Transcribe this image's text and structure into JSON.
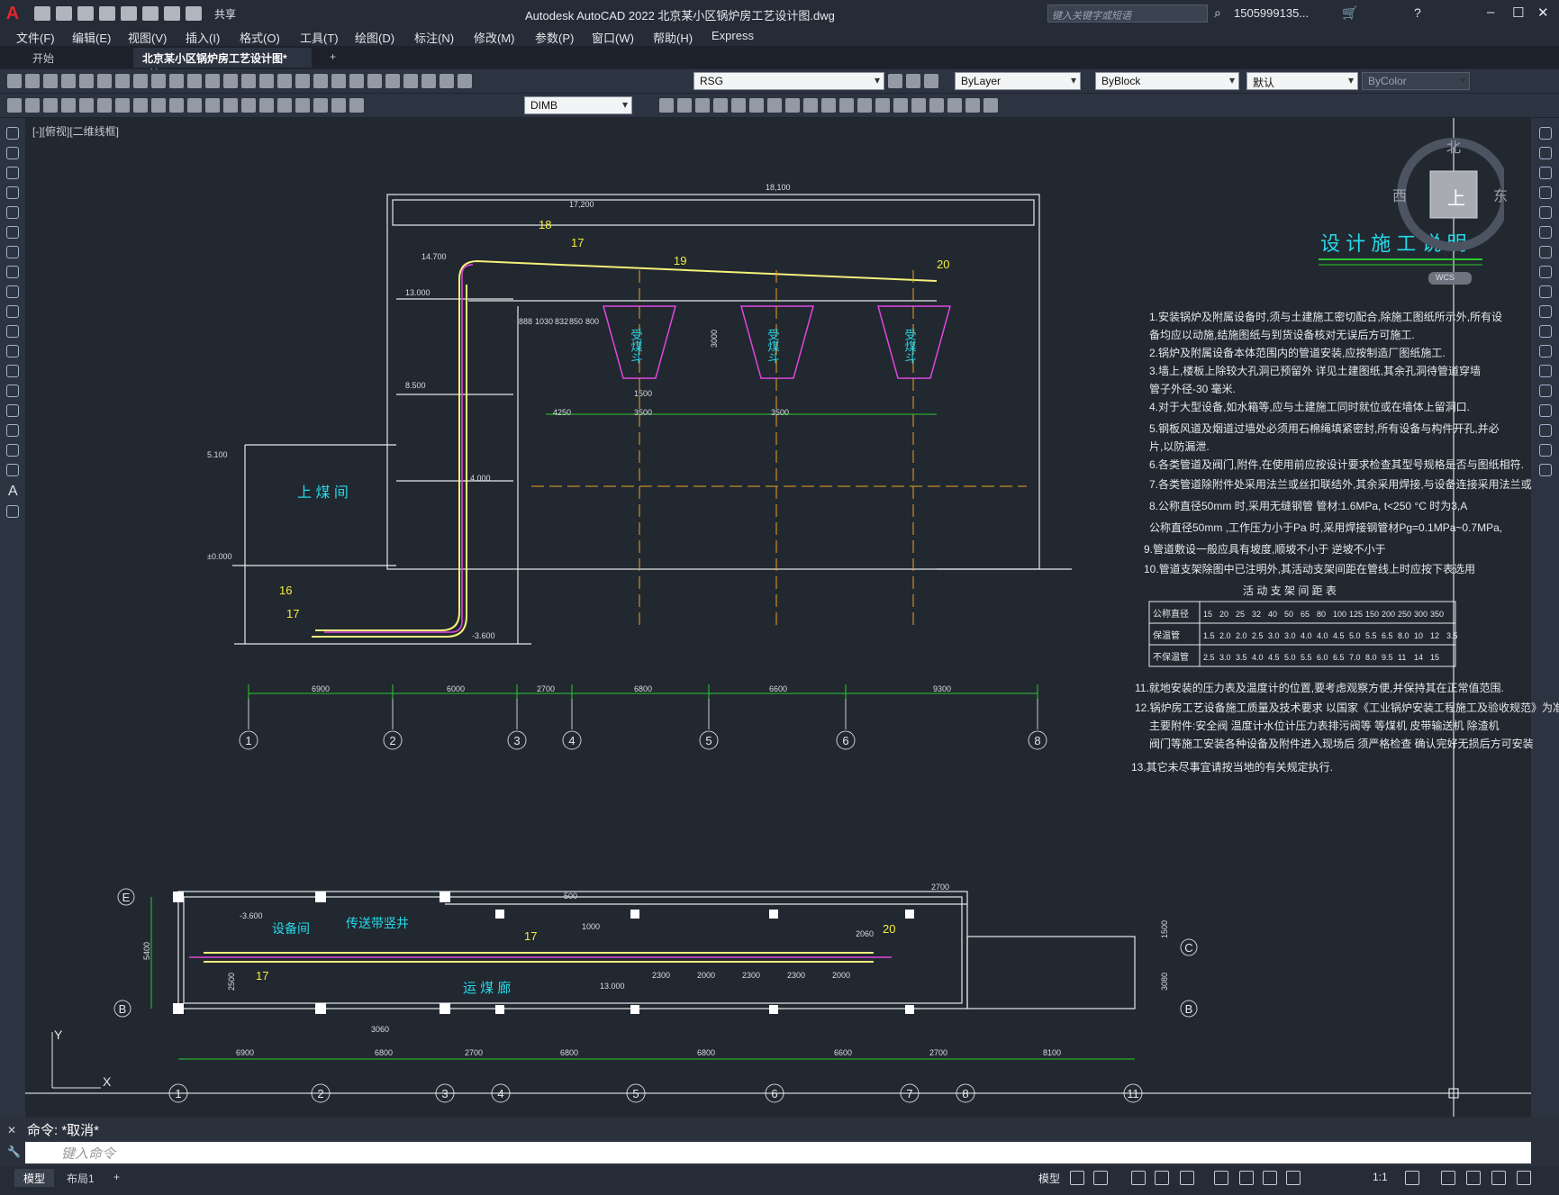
{
  "app": {
    "window_title": "Autodesk AutoCAD 2022    北京某小区锅炉房工艺设计图.dwg",
    "share_label": "共享",
    "search_placeholder": "键入关键字或短语",
    "user_name": "1505999135...",
    "window_controls": [
      "minimize-icon",
      "maximize-icon",
      "close-icon"
    ]
  },
  "menu": [
    "文件(F)",
    "编辑(E)",
    "视图(V)",
    "插入(I)",
    "格式(O)",
    "工具(T)",
    "绘图(D)",
    "标注(N)",
    "修改(M)",
    "参数(P)",
    "窗口(W)",
    "帮助(H)",
    "Express"
  ],
  "tabs": {
    "start": "开始",
    "active": "北京某小区锅炉房工艺设计图*",
    "add": "+"
  },
  "toolbar": {
    "layer": "RSG",
    "color": "ByLayer",
    "linetype": "ByBlock",
    "lineweight": "默认",
    "plotstyle": "ByColor",
    "dimstyle": "DIMB"
  },
  "viewport": {
    "label": "[-][俯视][二维线框]",
    "compass": {
      "north": "北",
      "south": "上",
      "west": "西",
      "east": "东",
      "wcs": "WCS"
    }
  },
  "drawing": {
    "section_dims": [
      "18,100",
      "17,200",
      "14.700",
      "13.000",
      "8.500",
      "5.100",
      "4.000",
      "±0.000",
      "-3.600"
    ],
    "section_bottom_dims": [
      "6900",
      "6000",
      "2700",
      "6800",
      "6600",
      "9300"
    ],
    "section_small_dims": [
      "888",
      "1030",
      "832",
      "850",
      "800",
      "3000",
      "1500",
      "3500",
      "3500",
      "4250"
    ],
    "axis_labels_top": [
      "1",
      "2",
      "3",
      "4",
      "5",
      "6",
      "8"
    ],
    "room_labels": [
      "上 煤 间",
      "受煤斗",
      "受煤斗",
      "受煤斗"
    ],
    "callouts": [
      "18",
      "17",
      "19",
      "20",
      "16",
      "17"
    ],
    "plan_labels": [
      "设备间",
      "传送带竖井",
      "运 煤 廊",
      "-3.600",
      "13.000"
    ],
    "plan_top_dims": [
      "500",
      "1000",
      "2700"
    ],
    "plan_mid_dims": [
      "2300",
      "2000",
      "2300",
      "2300",
      "2000",
      "2060",
      "3060",
      "2500",
      "1500",
      "3080"
    ],
    "plan_bottom_dims": [
      "6900",
      "6800",
      "2700",
      "6800",
      "6800",
      "6600",
      "2700",
      "8100"
    ],
    "plan_left_dim": "5400",
    "axis_labels_bottom": [
      "1",
      "2",
      "3",
      "4",
      "5",
      "6",
      "7",
      "8",
      "11"
    ],
    "row_labels": [
      "E",
      "B",
      "C",
      "B"
    ],
    "plan_callouts": [
      "17",
      "17",
      "20"
    ],
    "ucs": {
      "y": "Y",
      "x": "X"
    },
    "notes_title": "设 计 施 工 说 明",
    "notes": [
      "1.安装锅炉及附属设备时,须与土建施工密切配合,除施工图纸所示外,所有设",
      "   备均应以动施,结施图纸与到货设备核对无误后方可施工.",
      "2.锅炉及附属设备本体范围内的管道安装,应按制造厂图纸施工.",
      "3.墙上,楼板上除较大孔洞已预留外  详见土建图纸,其余孔洞待管道穿墙",
      "   管子外径-30        毫米.",
      "4.对于大型设备,如水箱等,应与土建施工同时就位或在墙体上留洞口.",
      "5.钢板风道及烟道过墙处必须用石棉绳填紧密封,所有设备与构件开孔,并必",
      "   片,以防漏泄.",
      "6.各类管道及阀门,附件,在使用前应按设计要求检查其型号规格是否与图纸相符.",
      "7.各类管道除附件处采用法兰或丝扣联结外,其余采用焊接,与设备连接采用法兰或",
      "8.公称直径50mm      时,采用无缝钢管   管材:1.6MPa,    t<250 °C 时为3,A",
      "公称直径50mm    ,工作压力小于Pa  时,采用焊接钢管材Pg=0.1MPa~0.7MPa,",
      "9.管道敷设一般应具有坡度,顺坡不小于       逆坡不小于",
      "10.管道支架除图中已注明外,其活动支架间距在管线上时应按下表选用"
    ],
    "table_title": "活 动 支 架 间 距 表",
    "table_rows": [
      [
        "公称直径",
        "15",
        "20",
        "25",
        "32",
        "40",
        "50",
        "65",
        "80",
        "100",
        "125",
        "150",
        "200",
        "250",
        "300",
        "350"
      ],
      [
        "保温管",
        "1.5",
        "2.0",
        "2.0",
        "2.5",
        "3.0",
        "3.0",
        "4.0",
        "4.0",
        "4.5",
        "5.0",
        "5.5",
        "6.5",
        "8.0",
        "10",
        "12",
        "3.5"
      ],
      [
        "不保温管",
        "2.5",
        "3.0",
        "3.5",
        "4.0",
        "4.5",
        "5.0",
        "5.5",
        "6.0",
        "6.5",
        "7.0",
        "8.0",
        "9.5",
        "11",
        "14",
        "15"
      ]
    ],
    "notes2": [
      "11.就地安装的压力表及温度计的位置,要考虑观察方便,并保持其在正常值范围.",
      "12.锅炉房工艺设备施工质量及技术要求  以国家《工业锅炉安装工程施工及验收规范》为准",
      "   主要附件:安全阀  温度计水位计压力表排污阀等  等煤机  皮带输送机  除渣机",
      "   阀门等施工安装各种设备及附件进入现场后  须严格检查  确认完好无损后方可安装",
      "13.其它未尽事宜请按当地的有关规定执行."
    ]
  },
  "command": {
    "history": "命令: *取消*",
    "placeholder": "键入命令"
  },
  "layouts": [
    "模型",
    "布局1",
    "+"
  ],
  "status": {
    "mode": "模型",
    "scale": "1:1"
  }
}
